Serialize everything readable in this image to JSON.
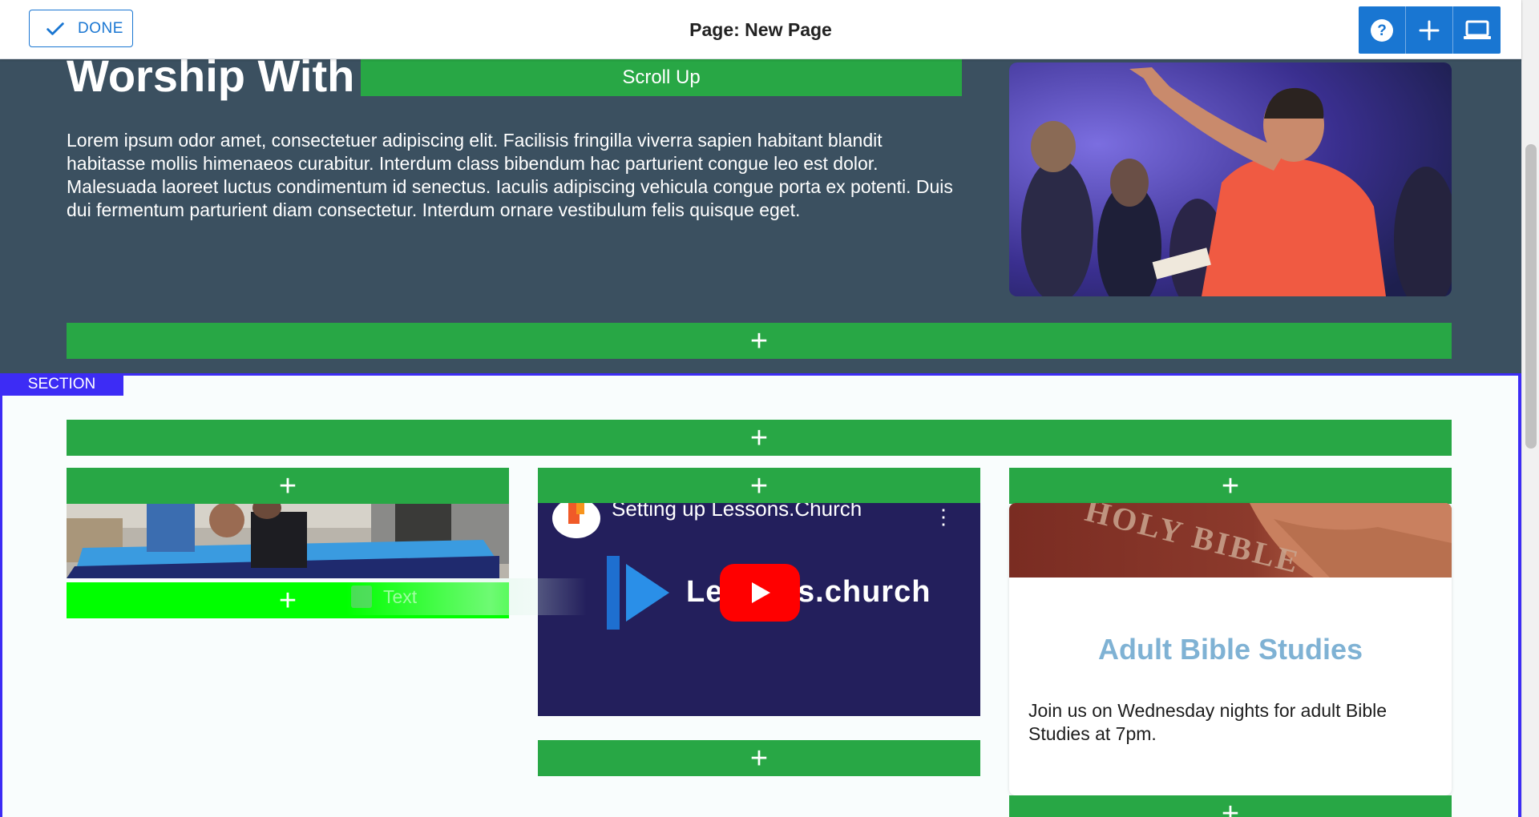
{
  "toolbar": {
    "done_label": "DONE",
    "page_title": "Page: New Page",
    "help_icon": "help-icon",
    "add_icon": "plus-icon",
    "preview_icon": "laptop-icon"
  },
  "hero": {
    "heading": "Worship With Us",
    "scroll_up_label": "Scroll Up",
    "body": "Lorem ipsum odor amet, consectetuer adipiscing elit. Facilisis fringilla viverra sapien habitant blandit habitasse mollis himenaeos curabitur. Interdum class bibendum hac parturient congue leo est dolor. Malesuada laoreet luctus condimentum id senectus. Iaculis adipiscing vehicula congue porta ex potenti. Duis dui fermentum parturient diam consectetur. Interdum ornare vestibulum felis quisque eget.",
    "add_label": "+"
  },
  "section": {
    "tag_label": "SECTION",
    "add_label": "+",
    "columns": [
      {
        "add_label": "+",
        "drop_add_label": "+"
      },
      {
        "add_label": "+",
        "bottom_add_label": "+",
        "video_title": "Setting up Lessons.Church",
        "video_brand": "Lessons.church",
        "kebab": "⋮"
      },
      {
        "add_label": "+",
        "bottom_add_label": "+",
        "card_image_text": "HOLY BIBLE",
        "card_title": "Adult Bible Studies",
        "card_text": "Join us on Wednesday nights for adult Bible Studies at 7pm."
      }
    ]
  },
  "drag_ghost": {
    "label": "Text",
    "icon": "document-icon"
  },
  "colors": {
    "add_bar": "#28a745",
    "drop_target": "#00ff00",
    "section_border": "#3d2cf5",
    "toolbar_accent": "#1976d2",
    "dark_bg": "#3b5060",
    "card_title": "#7fb2d4"
  }
}
